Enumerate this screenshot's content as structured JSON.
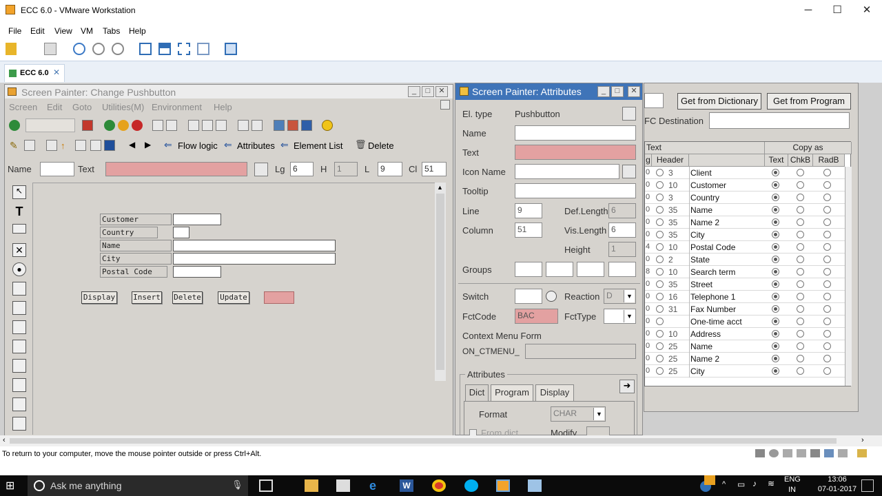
{
  "vm": {
    "title": "ECC 6.0 - VMware Workstation",
    "menu": [
      "File",
      "Edit",
      "View",
      "VM",
      "Tabs",
      "Help"
    ],
    "tab_label": "ECC 6.0",
    "status": "To return to your computer, move the mouse pointer outside or press Ctrl+Alt."
  },
  "painter": {
    "title": "Screen Painter:  Change Pushbutton",
    "menu": [
      "Screen",
      "Edit",
      "Goto",
      "Utilities(M)",
      "Environment",
      "Help"
    ],
    "toolbar": {
      "flow_logic": "Flow logic",
      "attributes": "Attributes",
      "element_list": "Element List",
      "delete": "Delete"
    },
    "fields": {
      "name_label": "Name",
      "text_label": "Text",
      "lg_label": "Lg",
      "lg_value": "6",
      "h_label": "H",
      "h_value": "1",
      "l_label": "L",
      "l_value": "9",
      "cl_label": "Cl",
      "cl_value": "51"
    },
    "canvas": {
      "labels": [
        "Customer",
        "Country",
        "Name",
        "City",
        "Postal Code"
      ],
      "buttons": [
        "Display",
        "Insert",
        "Delete",
        "Update"
      ]
    }
  },
  "attributes": {
    "title": "Screen Painter: Attributes",
    "el_type_label": "El. type",
    "el_type_value": "Pushbutton",
    "name_label": "Name",
    "text_label": "Text",
    "icon_name_label": "Icon Name",
    "tooltip_label": "Tooltip",
    "line_label": "Line",
    "line_value": "9",
    "column_label": "Column",
    "column_value": "51",
    "def_length_label": "Def.Length",
    "def_length_value": "6",
    "vis_length_label": "Vis.Length",
    "vis_length_value": "6",
    "height_label": "Height",
    "height_value": "1",
    "groups_label": "Groups",
    "switch_label": "Switch",
    "reaction_label": "Reaction",
    "reaction_value": "D",
    "fctcode_label": "FctCode",
    "fctcode_value": "BAC",
    "fcttype_label": "FctType",
    "context_menu_label": "Context Menu Form",
    "on_ctmenu_label": "ON_CTMENU_",
    "attributes_group": "Attributes",
    "tabs": [
      "Dict",
      "Program",
      "Display"
    ],
    "format_label": "Format",
    "format_value": "CHAR",
    "from_dict_label": "From dict.",
    "modify_label": "Modify"
  },
  "dictionary": {
    "get_from_dict": "Get from Dictionary",
    "get_from_program": "Get from Program",
    "rfc_label": "FC Destination",
    "text_header": "Text",
    "copy_as_header": "Copy as",
    "col_headers": [
      "g",
      "Header",
      "Text",
      "ChkB",
      "RadB"
    ],
    "rows": [
      {
        "c0": "0",
        "len": "3",
        "text": "Client",
        "sel": "text"
      },
      {
        "c0": "0",
        "len": "10",
        "text": "Customer",
        "sel": "text"
      },
      {
        "c0": "0",
        "len": "3",
        "text": "Country",
        "sel": "text"
      },
      {
        "c0": "0",
        "len": "35",
        "text": "Name",
        "sel": "text"
      },
      {
        "c0": "0",
        "len": "35",
        "text": "Name 2",
        "sel": "text"
      },
      {
        "c0": "0",
        "len": "35",
        "text": "City",
        "sel": "text"
      },
      {
        "c0": "4",
        "len": "10",
        "text": "Postal Code",
        "sel": "text"
      },
      {
        "c0": "0",
        "len": "2",
        "text": "State",
        "sel": "text"
      },
      {
        "c0": "8",
        "len": "10",
        "text": "Search term",
        "sel": "text"
      },
      {
        "c0": "0",
        "len": "35",
        "text": "Street",
        "sel": "text"
      },
      {
        "c0": "0",
        "len": "16",
        "text": "Telephone 1",
        "sel": "text"
      },
      {
        "c0": "0",
        "len": "31",
        "text": "Fax Number",
        "sel": "text"
      },
      {
        "c0": "0",
        "len": "",
        "text": "One-time acct",
        "sel": "text"
      },
      {
        "c0": "0",
        "len": "10",
        "text": "Address",
        "sel": "text"
      },
      {
        "c0": "0",
        "len": "25",
        "text": "Name",
        "sel": "text"
      },
      {
        "c0": "0",
        "len": "25",
        "text": "Name 2",
        "sel": "text"
      },
      {
        "c0": "0",
        "len": "25",
        "text": "City",
        "sel": "text"
      }
    ]
  },
  "taskbar": {
    "search_placeholder": "Ask me anything",
    "lang": "ENG",
    "lang2": "IN",
    "time": "13:06",
    "date": "07-01-2017"
  }
}
